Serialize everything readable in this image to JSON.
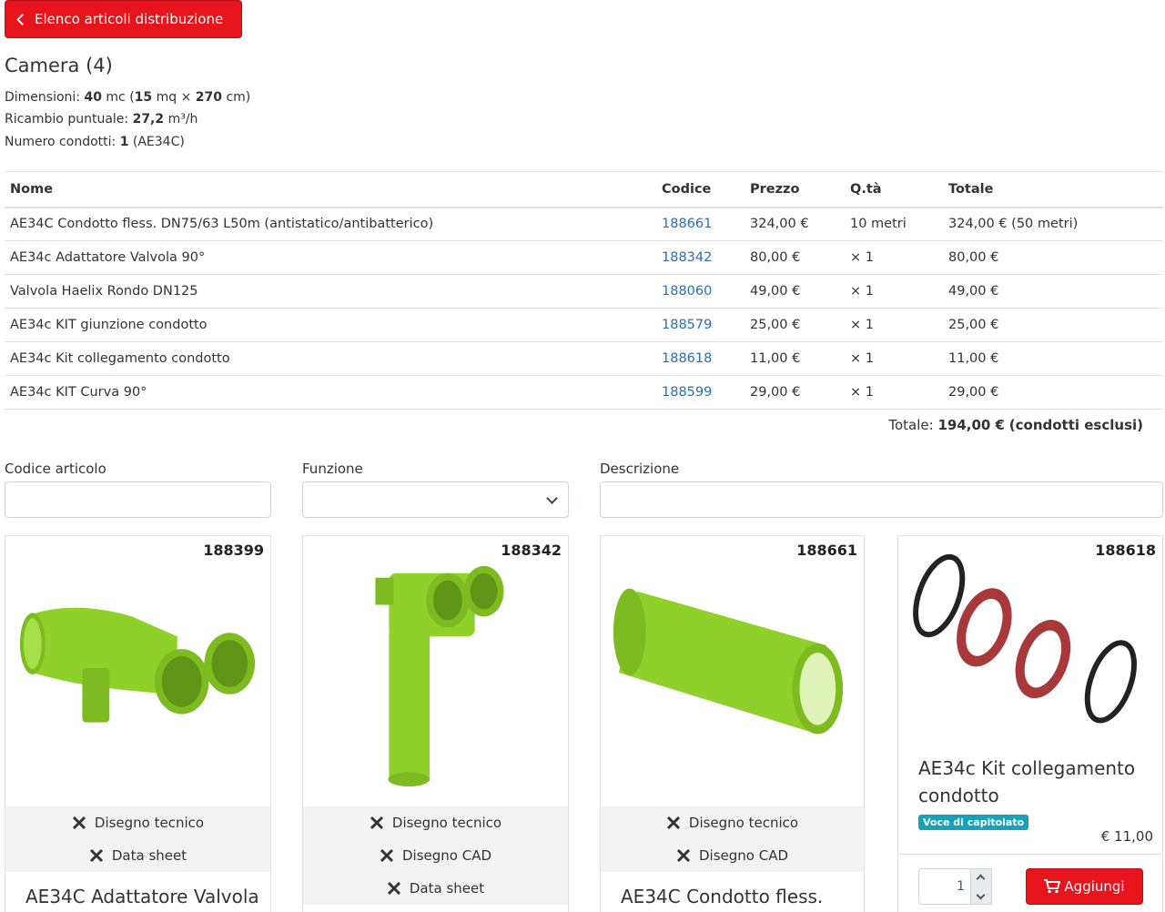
{
  "back_button": {
    "label": "Elenco articoli distribuzione"
  },
  "room": {
    "title": "Camera (4)",
    "dimensions_label": "Dimensioni:",
    "volume": "40",
    "volume_unit": "mc (",
    "area": "15",
    "area_unit": "mq ×",
    "height": "270",
    "height_unit": "cm)",
    "exchange_label": "Ricambio puntuale:",
    "exchange_value": "27,2",
    "exchange_unit": "m³/h",
    "ducts_label": "Numero condotti:",
    "ducts_value": "1",
    "ducts_code": "(AE34C)"
  },
  "table": {
    "headers": [
      "Nome",
      "Codice",
      "Prezzo",
      "Q.tà",
      "Totale"
    ],
    "rows": [
      {
        "name": "AE34C Condotto fless. DN75/63 L50m (antistatico/antibatterico)",
        "code": "188661",
        "price": "324,00 €",
        "qty": "10 metri",
        "total": "324,00 € (50 metri)"
      },
      {
        "name": "AE34c Adattatore Valvola 90°",
        "code": "188342",
        "price": "80,00 €",
        "qty": "× 1",
        "total": "80,00 €"
      },
      {
        "name": "Valvola Haelix Rondo DN125",
        "code": "188060",
        "price": "49,00 €",
        "qty": "× 1",
        "total": "49,00 €"
      },
      {
        "name": "AE34c KIT giunzione condotto",
        "code": "188579",
        "price": "25,00 €",
        "qty": "× 1",
        "total": "25,00 €"
      },
      {
        "name": "AE34c Kit collegamento condotto",
        "code": "188618",
        "price": "11,00 €",
        "qty": "× 1",
        "total": "11,00 €"
      },
      {
        "name": "AE34c KIT Curva 90°",
        "code": "188599",
        "price": "29,00 €",
        "qty": "× 1",
        "total": "29,00 €"
      }
    ],
    "grand_total_label": "Totale:",
    "grand_total_value": "194,00 €",
    "grand_total_note": "(condotti esclusi)"
  },
  "filters": {
    "code_label": "Codice articolo",
    "function_label": "Funzione",
    "description_label": "Descrizione"
  },
  "cards": [
    {
      "code": "188399",
      "links": [
        "Disegno tecnico",
        "Data sheet"
      ],
      "name": "AE34C Adattatore Valvola"
    },
    {
      "code": "188342",
      "links": [
        "Disegno tecnico",
        "Disegno CAD",
        "Data sheet"
      ]
    },
    {
      "code": "188661",
      "links": [
        "Disegno tecnico",
        "Disegno CAD"
      ],
      "name": "AE34C Condotto fless."
    },
    {
      "code": "188618",
      "name_line1": "AE34c Kit collegamento",
      "name_line2": "condotto",
      "badge": "Voce di capitolato",
      "price": "€ 11,00",
      "qty": "1",
      "add_label": "Aggiungi"
    }
  ],
  "colors": {
    "brand_red": "#e8141c",
    "link_blue": "#2a6fb5",
    "badge_teal": "#17a2b8",
    "product_green": "#8fd12a",
    "product_red": "#a8383a"
  }
}
